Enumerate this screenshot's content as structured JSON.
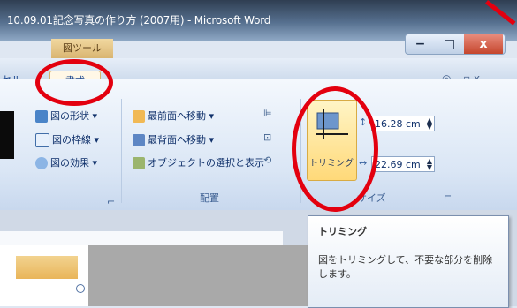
{
  "window": {
    "title": "10.09.01記念写真の作り方 (2007用) - Microsoft Word",
    "context_tab": "図ツール",
    "buttons": {
      "minimize": "−",
      "maximize": "□",
      "close": "x"
    }
  },
  "tabs": {
    "partial_left": "セル",
    "active": "書式",
    "right_controls": "◎ _ ▫ x"
  },
  "ribbon": {
    "picture_styles": [
      {
        "label": "図の形状 ▾",
        "icon": "shape-icon"
      },
      {
        "label": "図の枠線 ▾",
        "icon": "border-icon"
      },
      {
        "label": "図の効果 ▾",
        "icon": "effect-icon"
      }
    ],
    "arrange": [
      {
        "label": "最前面へ移動 ▾",
        "icon": "bring-front-icon"
      },
      {
        "label": "最背面へ移動 ▾",
        "icon": "send-back-icon"
      },
      {
        "label": "オブジェクトの選択と表示",
        "icon": "selection-pane-icon"
      }
    ],
    "arrange_group_label": "配置",
    "size_group_label": "サイズ",
    "trim_label": "トリミング",
    "height_value": "16.28 cm",
    "width_value": "22.69 cm"
  },
  "tooltip": {
    "title": "トリミング",
    "body": "図をトリミングして、不要な部分を削除します。"
  },
  "colors": {
    "highlight": "#e3000f",
    "accent": "#15428b"
  }
}
